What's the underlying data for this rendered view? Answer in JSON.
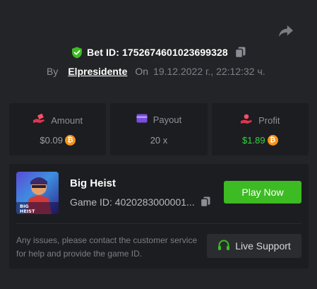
{
  "header": {
    "bet_label": "Bet ID: 1752674601023699328",
    "by_label": "By",
    "username": "Elpresidente",
    "on_label": "On",
    "date": "19.12.2022 г., 22:12:32 ч."
  },
  "stats": [
    {
      "label": "Amount",
      "value": "$0.09",
      "icon": "bet-hand-icon",
      "currency_icon": "bitcoin-icon"
    },
    {
      "label": "Payout",
      "value": "20 x",
      "icon": "wallet-card-icon"
    },
    {
      "label": "Profit",
      "value": "$1.89",
      "icon": "profit-hand-icon",
      "currency_icon": "bitcoin-icon",
      "value_color": "#39d244"
    }
  ],
  "game": {
    "title": "Big Heist",
    "game_id": "Game ID: 4020283000001...",
    "thumbnail_text": "BIG HEIST",
    "play_label": "Play Now"
  },
  "support": {
    "help_text": "Any issues, please contact the customer service for help and provide the game ID.",
    "button_label": "Live Support"
  },
  "colors": {
    "accent_green": "#3dbb23",
    "profit_green": "#39d244",
    "bitcoin": "#f7931a"
  }
}
